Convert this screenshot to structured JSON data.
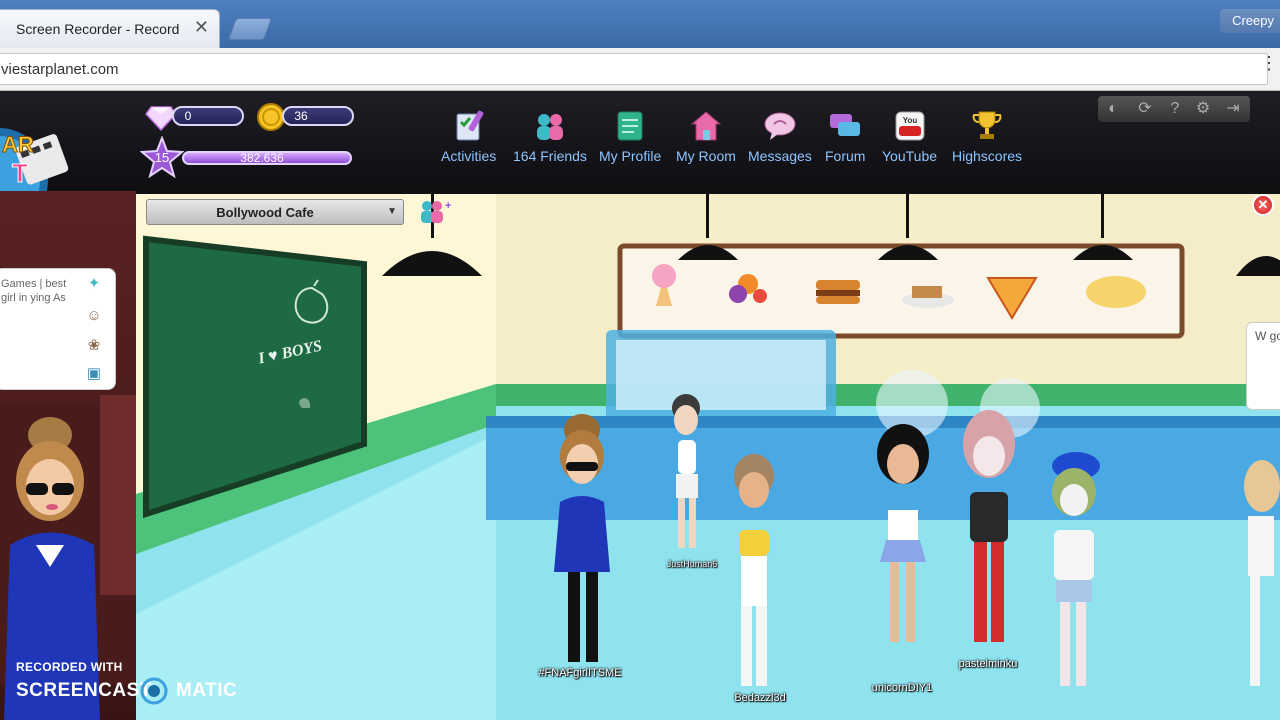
{
  "browser": {
    "tab_title": "Screen Recorder - Record",
    "tab_close": "✕",
    "user_name": "Creepy",
    "url": "viestarplanet.com"
  },
  "hud": {
    "diamonds": "0",
    "coins": "36",
    "level": "15",
    "fame": "382.636"
  },
  "nav": [
    {
      "label": "Activities",
      "icon": "activities-icon"
    },
    {
      "label": "164 Friends",
      "icon": "friends-icon"
    },
    {
      "label": "My Profile",
      "icon": "profile-icon"
    },
    {
      "label": "My Room",
      "icon": "room-icon"
    },
    {
      "label": "Messages",
      "icon": "messages-icon"
    },
    {
      "label": "Forum",
      "icon": "forum-icon"
    },
    {
      "label": "YouTube",
      "icon": "youtube-icon"
    },
    {
      "label": "Highscores",
      "icon": "trophy-icon"
    }
  ],
  "top_icons": [
    "sound-icon",
    "refresh-icon",
    "help-icon",
    "settings-icon",
    "logout-icon"
  ],
  "chat": {
    "text": "Games | best girl in ying As"
  },
  "room": {
    "name": "Bollywood Cafe",
    "chalkboard": "I ♥ BOYS",
    "close": "✕",
    "side_text": "W go"
  },
  "avatars": [
    {
      "name": "#FNAFgirlITSME"
    },
    {
      "name": "JustHuman6"
    },
    {
      "name": "Bedazzl3d"
    },
    {
      "name": "unicornDIY1"
    },
    {
      "name": "pastelminku"
    }
  ],
  "watermark": {
    "recorded_with": "RECORDED WITH",
    "screencast": "SCREENCAST",
    "matic": "MATIC"
  },
  "colors": {
    "nav_text": "#8ec5ff",
    "accent_purple": "#8e4fd6",
    "close_red": "#c91b1b"
  }
}
